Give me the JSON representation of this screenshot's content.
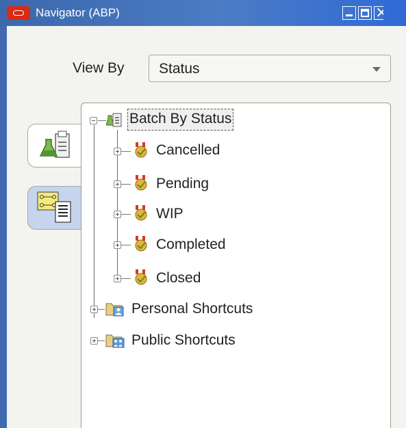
{
  "window": {
    "title": "Navigator (ABP)",
    "controls": [
      "minimize-icon",
      "maximize-icon",
      "close-icon"
    ],
    "colors": {
      "titlebar": "#3c68ad",
      "logo": "#d72b16",
      "selection_tab": "#c6d4ee"
    }
  },
  "view_by": {
    "label": "View By",
    "selected": "Status"
  },
  "side_tabs": [
    {
      "icon": "document-icon",
      "selected": false
    },
    {
      "icon": "process-flow-icon",
      "selected": true
    }
  ],
  "tree": {
    "root": {
      "label": "Batch By Status",
      "icon": "batch-icon",
      "expanded": true,
      "selected": true,
      "children": [
        {
          "label": "Cancelled",
          "icon": "batch-status-icon"
        },
        {
          "label": "Pending",
          "icon": "batch-status-icon"
        },
        {
          "label": "WIP",
          "icon": "batch-status-icon"
        },
        {
          "label": "Completed",
          "icon": "batch-status-icon"
        },
        {
          "label": "Closed",
          "icon": "batch-status-icon"
        }
      ]
    },
    "shortcuts": [
      {
        "label": "Personal Shortcuts",
        "icon": "personal-folder-icon"
      },
      {
        "label": "Public Shortcuts",
        "icon": "public-folder-icon"
      }
    ]
  }
}
